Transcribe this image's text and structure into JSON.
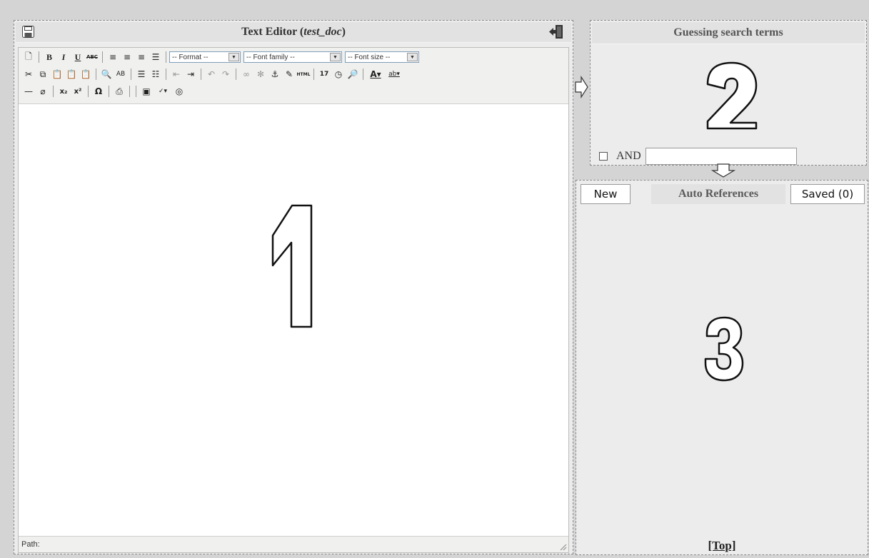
{
  "editor": {
    "title_prefix": "Text Editor (",
    "title_doc": "test_doc",
    "title_suffix": ")",
    "format_select": "-- Format --",
    "font_family_select": "-- Font family --",
    "font_size_select": "-- Font size --",
    "path_label": "Path:",
    "panel_number": "1"
  },
  "guess": {
    "title": "Guessing search terms",
    "panel_number": "2",
    "and_label": "AND",
    "and_value": ""
  },
  "refs": {
    "new_tab": "New",
    "title": "Auto References",
    "saved_tab": "Saved (0)",
    "panel_number": "3",
    "top_link": "[Top]"
  },
  "toolbar": {
    "row1": [
      "new-document-icon",
      "sep",
      "bold-icon",
      "italic-icon",
      "underline-icon",
      "strikethrough-icon",
      "sep",
      "align-left-icon",
      "align-center-icon",
      "align-right-icon",
      "justify-icon",
      "sep"
    ],
    "row2": [
      "cut-icon",
      "copy-icon",
      "paste-icon",
      "paste-text-icon",
      "paste-word-icon",
      "sep",
      "find-icon",
      "replace-icon",
      "sep",
      "bullet-list-icon",
      "numbered-list-icon",
      "sep",
      "outdent-icon",
      "indent-icon",
      "sep",
      "undo-icon",
      "redo-icon",
      "sep",
      "link-icon",
      "unlink-icon",
      "anchor-icon",
      "cleanup-icon",
      "html-icon",
      "sep",
      "insert-date-icon",
      "insert-time-icon",
      "preview-icon",
      "sep",
      "text-color-icon",
      "highlight-color-icon"
    ],
    "row3": [
      "horizontal-rule-icon",
      "remove-format-icon",
      "sep",
      "subscript-icon",
      "superscript-icon",
      "sep",
      "special-char-icon",
      "sep",
      "print-icon",
      "sep",
      "sep",
      "fullscreen-icon",
      "spellcheck-icon",
      "help-icon"
    ]
  }
}
